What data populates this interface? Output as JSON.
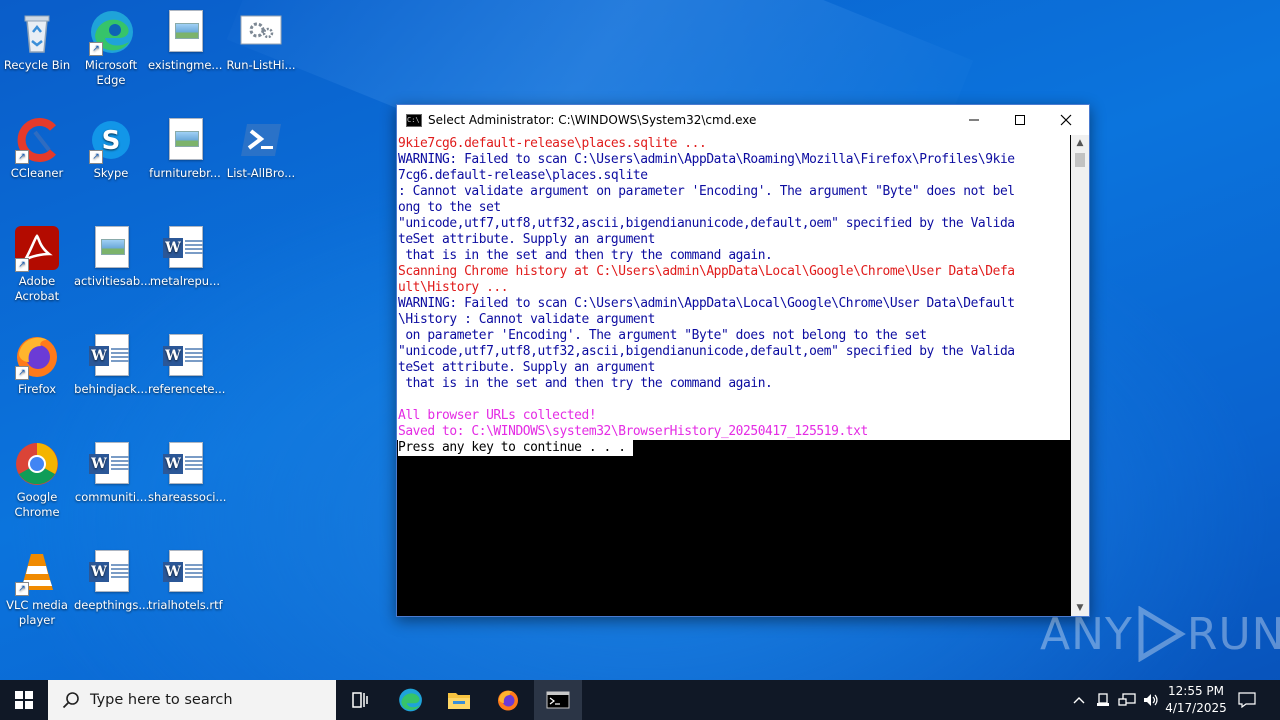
{
  "desktop": {
    "icons": [
      {
        "label": "Recycle Bin"
      },
      {
        "label": "Microsoft Edge"
      },
      {
        "label": "existingme..."
      },
      {
        "label": "Run-ListHi..."
      },
      {
        "label": "CCleaner"
      },
      {
        "label": "Skype"
      },
      {
        "label": "furniturebr..."
      },
      {
        "label": "List-AllBro..."
      },
      {
        "label": "Adobe Acrobat"
      },
      {
        "label": "activitiesab..."
      },
      {
        "label": "metalrepu..."
      },
      {
        "label": "Firefox"
      },
      {
        "label": "behindjack..."
      },
      {
        "label": "referencete..."
      },
      {
        "label": "Google Chrome"
      },
      {
        "label": "communiti..."
      },
      {
        "label": "shareassoci..."
      },
      {
        "label": "VLC media player"
      },
      {
        "label": "deepthings..."
      },
      {
        "label": "trialhotels.rtf"
      }
    ]
  },
  "cmd_window": {
    "title": "Select Administrator: C:\\WINDOWS\\System32\\cmd.exe",
    "lines": [
      {
        "text": "9kie7cg6.default-release\\places.sqlite ...",
        "color": "red"
      },
      {
        "text": "WARNING: Failed to scan C:\\Users\\admin\\AppData\\Roaming\\Mozilla\\Firefox\\Profiles\\9kie",
        "color": "blue"
      },
      {
        "text": "7cg6.default-release\\places.sqlite",
        "color": "blue"
      },
      {
        "text": ": Cannot validate argument on parameter 'Encoding'. The argument \"Byte\" does not bel",
        "color": "blue"
      },
      {
        "text": "ong to the set",
        "color": "blue"
      },
      {
        "text": "\"unicode,utf7,utf8,utf32,ascii,bigendianunicode,default,oem\" specified by the Valida",
        "color": "blue"
      },
      {
        "text": "teSet attribute. Supply an argument",
        "color": "blue"
      },
      {
        "text": " that is in the set and then try the command again.",
        "color": "blue"
      },
      {
        "text": "Scanning Chrome history at C:\\Users\\admin\\AppData\\Local\\Google\\Chrome\\User Data\\Defa",
        "color": "red"
      },
      {
        "text": "ult\\History ...",
        "color": "red"
      },
      {
        "text": "WARNING: Failed to scan C:\\Users\\admin\\AppData\\Local\\Google\\Chrome\\User Data\\Default",
        "color": "blue"
      },
      {
        "text": "\\History : Cannot validate argument",
        "color": "blue"
      },
      {
        "text": " on parameter 'Encoding'. The argument \"Byte\" does not belong to the set",
        "color": "blue"
      },
      {
        "text": "\"unicode,utf7,utf8,utf32,ascii,bigendianunicode,default,oem\" specified by the Valida",
        "color": "blue"
      },
      {
        "text": "teSet attribute. Supply an argument",
        "color": "blue"
      },
      {
        "text": " that is in the set and then try the command again.",
        "color": "blue"
      },
      {
        "text": "",
        "color": "blue"
      },
      {
        "text": "All browser URLs collected!",
        "color": "magenta"
      },
      {
        "text": "Saved to: C:\\WINDOWS\\system32\\BrowserHistory_20250417_125519.txt",
        "color": "magenta"
      },
      {
        "text": "Press any key to continue . . . ",
        "color": "plain"
      }
    ]
  },
  "watermark": {
    "text": "ANY",
    "text2": "RUN"
  },
  "taskbar": {
    "search_placeholder": "Type here to search",
    "time": "12:55 PM",
    "date": "4/17/2025",
    "apps": [
      "start-icon",
      "task-view-icon",
      "edge-icon",
      "file-explorer-icon",
      "firefox-icon",
      "cmd-icon"
    ]
  },
  "colors": {
    "console_red": "#e01b1b",
    "console_blue": "#0c0ca0",
    "console_magenta": "#e42ce4",
    "taskbar": "#101826",
    "desktop_blue": "#0b74dd"
  }
}
